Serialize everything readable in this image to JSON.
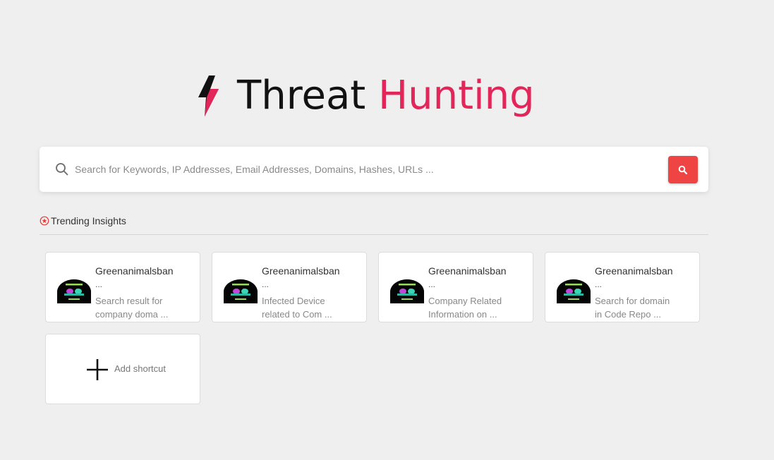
{
  "app": {
    "title_part1": "Threat",
    "title_part2": "Hunting",
    "accent_color": "#e2265a",
    "logo_icon": "lightning-bolt-icon"
  },
  "search": {
    "placeholder": "Search for Keywords, IP Addresses, Email Addresses, Domains, Hashes, URLs ...",
    "value": "",
    "leading_icon": "search-icon",
    "button_icon": "search-icon",
    "button_color": "#ee4444"
  },
  "trending": {
    "icon": "star-circle-icon",
    "label": "Trending Insights",
    "cards": [
      {
        "title": "Greenanimalsban",
        "ellipsis": "...",
        "desc_line1": "Search result for",
        "desc_line2": "company doma ...",
        "thumbnail": "oppressive-things-logo"
      },
      {
        "title": "Greenanimalsban",
        "ellipsis": "...",
        "desc_line1": "Infected Device",
        "desc_line2": "related to Com ...",
        "thumbnail": "oppressive-things-logo"
      },
      {
        "title": "Greenanimalsban",
        "ellipsis": "...",
        "desc_line1": "Company Related",
        "desc_line2": "Information on ...",
        "thumbnail": "oppressive-things-logo"
      },
      {
        "title": "Greenanimalsban",
        "ellipsis": "...",
        "desc_line1": "Search for domain",
        "desc_line2": "in Code Repo ...",
        "thumbnail": "oppressive-things-logo"
      }
    ]
  },
  "shortcut": {
    "label": "Add shortcut",
    "icon": "plus-icon"
  }
}
